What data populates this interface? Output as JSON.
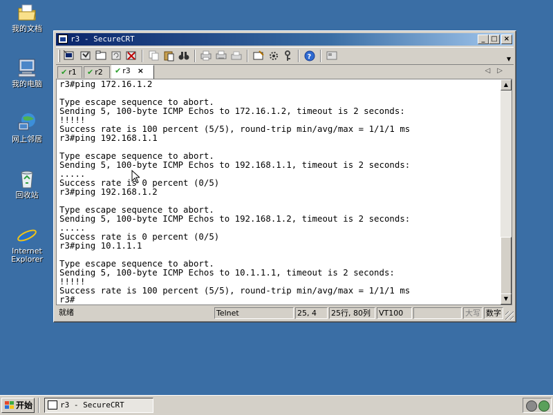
{
  "desktop": {
    "icons": [
      {
        "label": "我的文档",
        "icon": "my-documents-icon"
      },
      {
        "label": "我的电脑",
        "icon": "my-computer-icon"
      },
      {
        "label": "网上邻居",
        "icon": "network-places-icon"
      },
      {
        "label": "回收站",
        "icon": "recycle-bin-icon"
      },
      {
        "label": "Internet\nExplorer",
        "icon": "internet-explorer-icon"
      }
    ]
  },
  "window": {
    "title": "r3 - SecureCRT",
    "controls": {
      "minimize": "_",
      "maximize": "□",
      "close": "×"
    },
    "tabs": [
      {
        "label": "r1",
        "connected": true
      },
      {
        "label": "r2",
        "connected": true
      },
      {
        "label": "r3",
        "connected": true,
        "active": true,
        "close": "×"
      }
    ],
    "tab_scroll": {
      "left": "◁",
      "right": "▷"
    },
    "terminal_lines": [
      "r3#ping 172.16.1.2",
      "",
      "Type escape sequence to abort.",
      "Sending 5, 100-byte ICMP Echos to 172.16.1.2, timeout is 2 seconds:",
      "!!!!!",
      "Success rate is 100 percent (5/5), round-trip min/avg/max = 1/1/1 ms",
      "r3#ping 192.168.1.1",
      "",
      "Type escape sequence to abort.",
      "Sending 5, 100-byte ICMP Echos to 192.168.1.1, timeout is 2 seconds:",
      ".....",
      "Success rate is 0 percent (0/5)",
      "r3#ping 192.168.1.2",
      "",
      "Type escape sequence to abort.",
      "Sending 5, 100-byte ICMP Echos to 192.168.1.2, timeout is 2 seconds:",
      ".....",
      "Success rate is 0 percent (0/5)",
      "r3#ping 10.1.1.1",
      "",
      "Type escape sequence to abort.",
      "Sending 5, 100-byte ICMP Echos to 10.1.1.1, timeout is 2 seconds:",
      "!!!!!",
      "Success rate is 100 percent (5/5), round-trip min/avg/max = 1/1/1 ms",
      "r3#"
    ],
    "scrollbar": {
      "up": "▲",
      "down": "▼"
    },
    "status": {
      "ready": "就绪",
      "protocol": "Telnet",
      "cursor": "25,  4",
      "size": "25行, 80列",
      "emulation": "VT100",
      "blank": "",
      "caps": "大写",
      "num": "数字"
    }
  },
  "taskbar": {
    "start_label": "开始",
    "task_title": "r3 - SecureCRT"
  },
  "colors": {
    "desktop": "#3a6ea5",
    "titlebar_start": "#0a246a",
    "titlebar_end": "#a6caf0",
    "chrome": "#d4d0c8"
  }
}
